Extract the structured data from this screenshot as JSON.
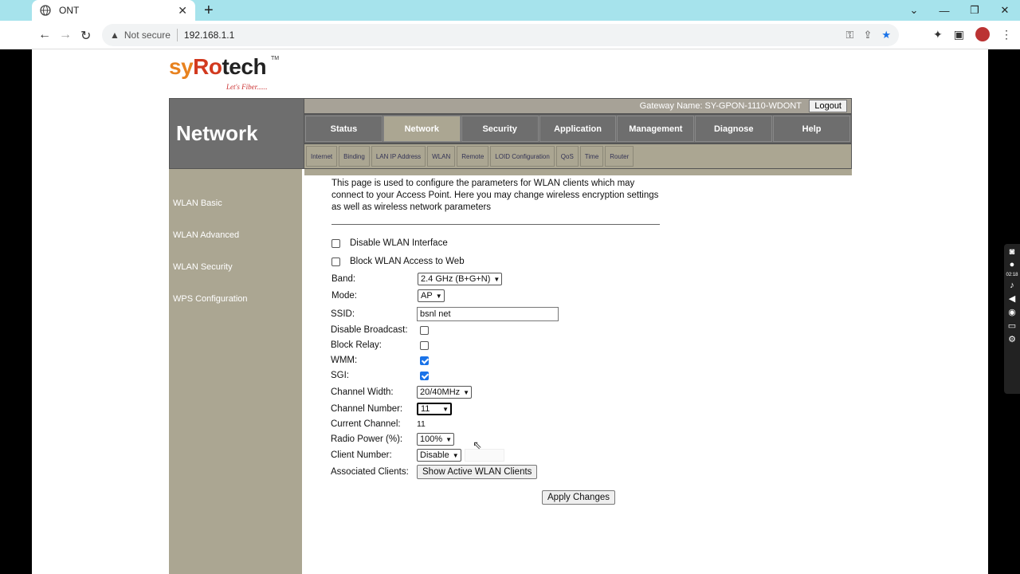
{
  "browser": {
    "tab_title": "ONT",
    "tab_close": "✕",
    "new_tab": "+",
    "security_label": "Not secure",
    "url": "192.168.1.1",
    "window_controls": [
      "⌄",
      "—",
      "❐",
      "✕"
    ]
  },
  "logo": {
    "part1": "sy",
    "part2": "Ro",
    "part3": "tech",
    "tm": "TM",
    "tagline": "Let's Fiber......"
  },
  "header": {
    "section_title": "Network",
    "gateway_name": "Gateway Name: SY-GPON-1110-WDONT",
    "logout_label": "Logout"
  },
  "main_nav": [
    {
      "label": "Status",
      "active": false
    },
    {
      "label": "Network",
      "active": true
    },
    {
      "label": "Security",
      "active": false
    },
    {
      "label": "Application",
      "active": false
    },
    {
      "label": "Management",
      "active": false
    },
    {
      "label": "Diagnose",
      "active": false
    },
    {
      "label": "Help",
      "active": false
    }
  ],
  "sub_nav": [
    "Internet",
    "Binding",
    "LAN IP Address",
    "WLAN",
    "Remote",
    "LOID Configuration",
    "QoS",
    "Time",
    "Router"
  ],
  "sidebar": [
    "WLAN Basic",
    "WLAN Advanced",
    "WLAN Security",
    "WPS Configuration"
  ],
  "content": {
    "intro": "This page is used to configure the parameters for WLAN clients which may connect to your Access Point. Here you may change wireless encryption settings as well as wireless network parameters",
    "disable_wlan_label": "Disable WLAN Interface",
    "block_wlan_web_label": "Block WLAN Access to Web",
    "band_label": "Band:",
    "band_value": "2.4 GHz (B+G+N)",
    "mode_label": "Mode:",
    "mode_value": "AP",
    "ssid_label": "SSID:",
    "ssid_value": "bsnl net",
    "disable_broadcast_label": "Disable Broadcast:",
    "disable_broadcast_checked": false,
    "block_relay_label": "Block Relay:",
    "block_relay_checked": false,
    "wmm_label": "WMM:",
    "wmm_checked": true,
    "sgi_label": "SGI:",
    "sgi_checked": true,
    "channel_width_label": "Channel Width:",
    "channel_width_value": "20/40MHz",
    "channel_number_label": "Channel Number:",
    "channel_number_value": "11",
    "current_channel_label": "Current Channel:",
    "current_channel_value": "11",
    "radio_power_label": "Radio Power (%):",
    "radio_power_value": "100%",
    "client_number_label": "Client Number:",
    "client_number_value": "Disable",
    "associated_clients_label": "Associated Clients:",
    "show_clients_button": "Show Active WLAN Clients",
    "apply_button": "Apply Changes"
  },
  "recorder": {
    "timer": "02:18"
  }
}
